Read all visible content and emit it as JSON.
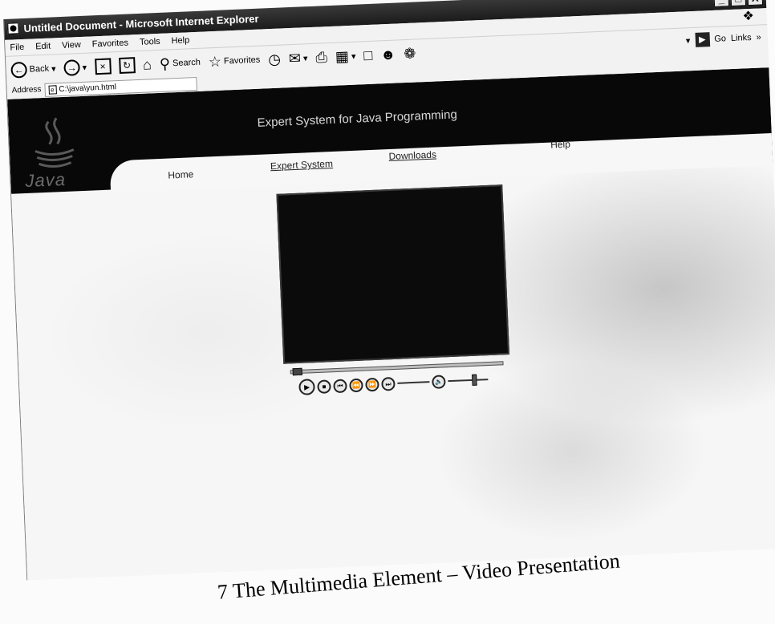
{
  "window": {
    "title": "Untitled Document - Microsoft Internet Explorer",
    "minimize": "_",
    "maximize": "□",
    "close": "X"
  },
  "menubar": {
    "items": [
      "File",
      "Edit",
      "View",
      "Favorites",
      "Tools",
      "Help"
    ]
  },
  "toolbar": {
    "back_label": "Back",
    "search_label": "Search",
    "favorites_label": "Favorites",
    "go_label": "Go",
    "links_label": "Links",
    "more": "»"
  },
  "address": {
    "label": "Address",
    "value": "C:\\java\\yun.html"
  },
  "page": {
    "site_title": "Expert System for Java Programming",
    "logo_text": "Java",
    "nav": {
      "home": "Home",
      "expert_system": "Expert System",
      "downloads": "Downloads",
      "help": "Help"
    }
  },
  "player": {
    "icons": [
      "play-icon",
      "stop-icon",
      "previous-icon",
      "rewind-icon",
      "fast-forward-icon",
      "next-icon",
      "volume-icon"
    ]
  },
  "caption": {
    "text": "7  The Multimedia Element – Video Presentation"
  }
}
